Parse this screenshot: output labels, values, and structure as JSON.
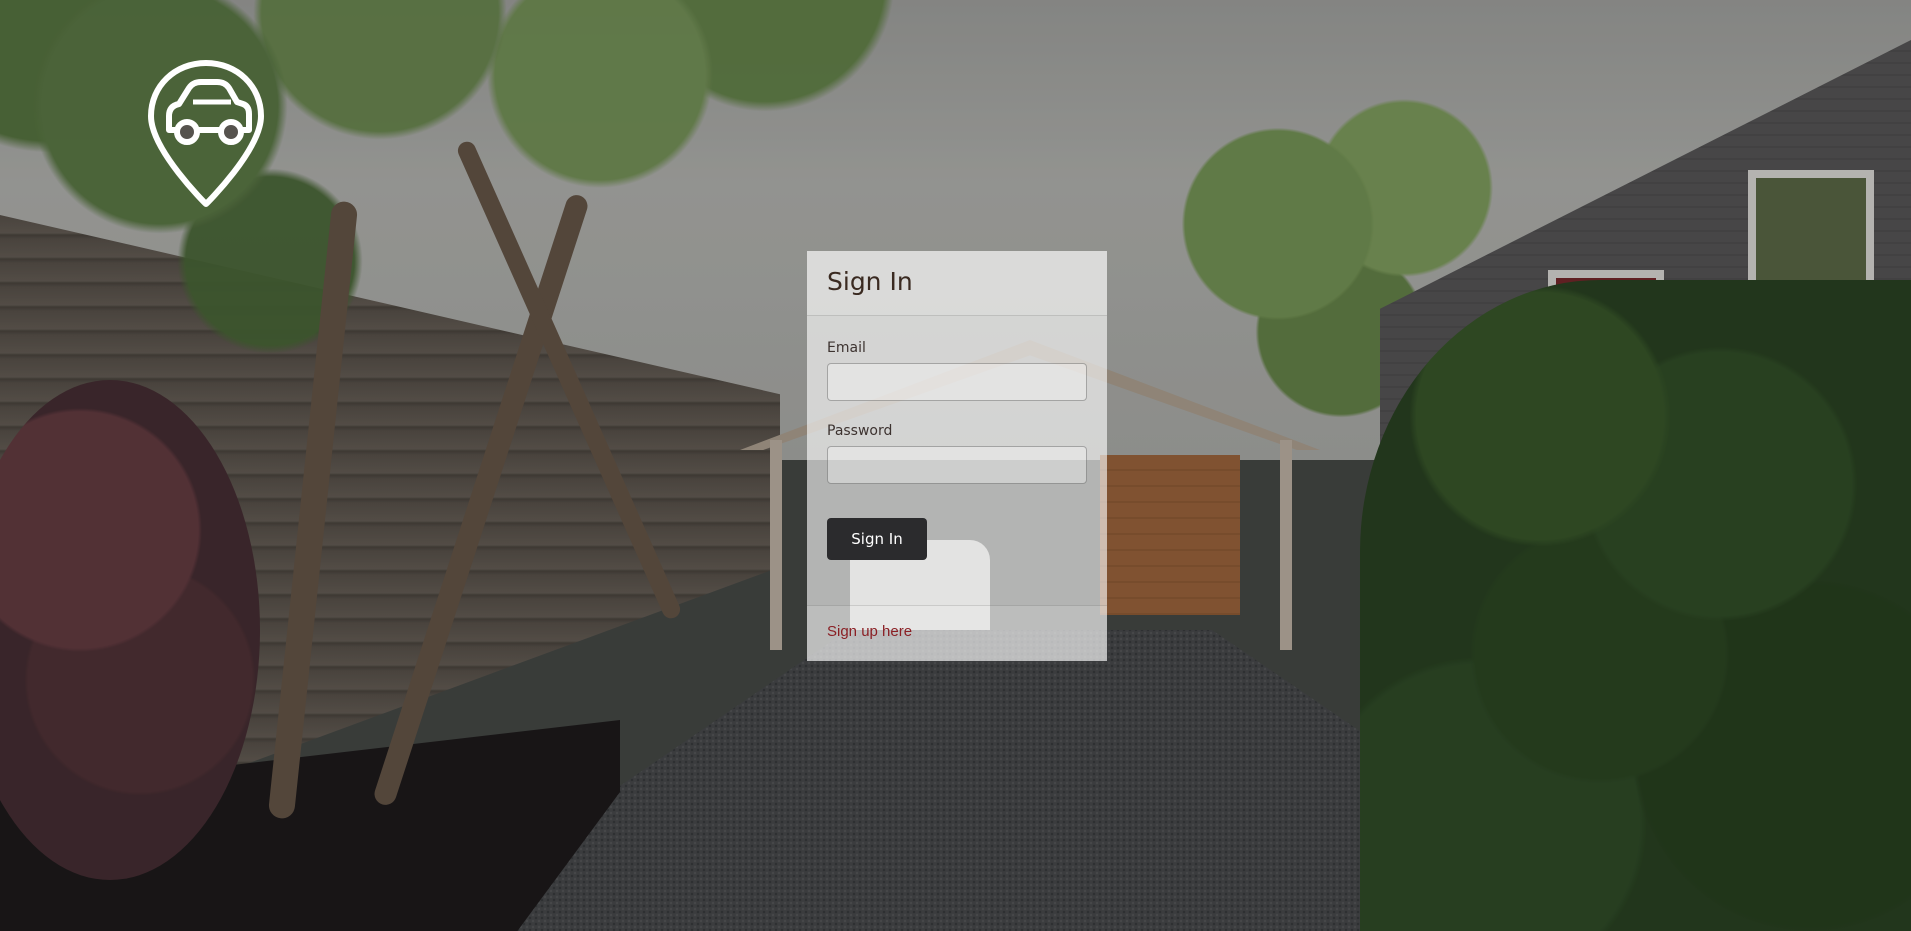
{
  "logo": {
    "icon": "car-location-pin-icon",
    "color": "#ffffff"
  },
  "signin_card": {
    "title": "Sign In",
    "email": {
      "label": "Email",
      "value": "",
      "placeholder": ""
    },
    "password": {
      "label": "Password",
      "value": "",
      "placeholder": ""
    },
    "submit_label": "Sign In",
    "signup_link_label": "Sign up here",
    "colors": {
      "button_bg": "#2b2b2d",
      "link": "#8a1f24",
      "title": "#3a2a21"
    }
  }
}
